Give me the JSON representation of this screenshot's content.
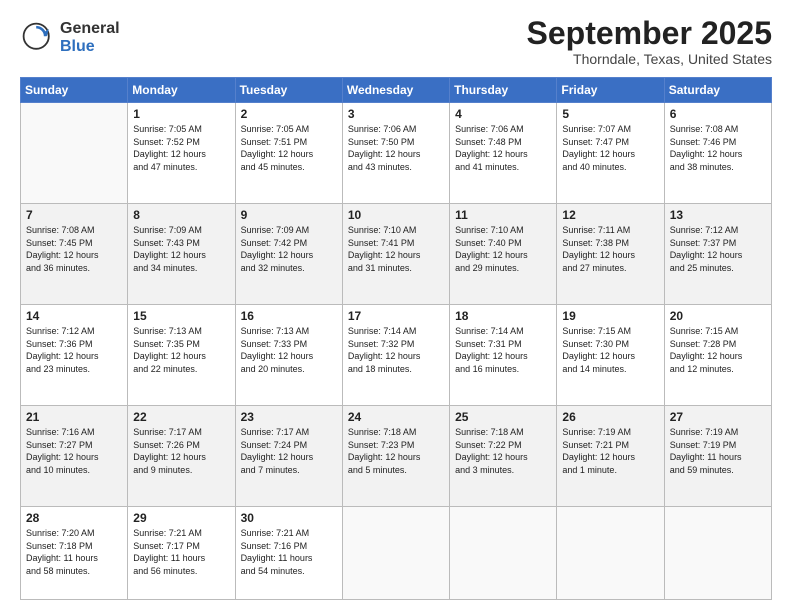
{
  "header": {
    "logo_general": "General",
    "logo_blue": "Blue",
    "month_title": "September 2025",
    "location": "Thorndale, Texas, United States"
  },
  "days_of_week": [
    "Sunday",
    "Monday",
    "Tuesday",
    "Wednesday",
    "Thursday",
    "Friday",
    "Saturday"
  ],
  "weeks": [
    [
      {
        "day": "",
        "info": ""
      },
      {
        "day": "1",
        "info": "Sunrise: 7:05 AM\nSunset: 7:52 PM\nDaylight: 12 hours\nand 47 minutes."
      },
      {
        "day": "2",
        "info": "Sunrise: 7:05 AM\nSunset: 7:51 PM\nDaylight: 12 hours\nand 45 minutes."
      },
      {
        "day": "3",
        "info": "Sunrise: 7:06 AM\nSunset: 7:50 PM\nDaylight: 12 hours\nand 43 minutes."
      },
      {
        "day": "4",
        "info": "Sunrise: 7:06 AM\nSunset: 7:48 PM\nDaylight: 12 hours\nand 41 minutes."
      },
      {
        "day": "5",
        "info": "Sunrise: 7:07 AM\nSunset: 7:47 PM\nDaylight: 12 hours\nand 40 minutes."
      },
      {
        "day": "6",
        "info": "Sunrise: 7:08 AM\nSunset: 7:46 PM\nDaylight: 12 hours\nand 38 minutes."
      }
    ],
    [
      {
        "day": "7",
        "info": "Sunrise: 7:08 AM\nSunset: 7:45 PM\nDaylight: 12 hours\nand 36 minutes."
      },
      {
        "day": "8",
        "info": "Sunrise: 7:09 AM\nSunset: 7:43 PM\nDaylight: 12 hours\nand 34 minutes."
      },
      {
        "day": "9",
        "info": "Sunrise: 7:09 AM\nSunset: 7:42 PM\nDaylight: 12 hours\nand 32 minutes."
      },
      {
        "day": "10",
        "info": "Sunrise: 7:10 AM\nSunset: 7:41 PM\nDaylight: 12 hours\nand 31 minutes."
      },
      {
        "day": "11",
        "info": "Sunrise: 7:10 AM\nSunset: 7:40 PM\nDaylight: 12 hours\nand 29 minutes."
      },
      {
        "day": "12",
        "info": "Sunrise: 7:11 AM\nSunset: 7:38 PM\nDaylight: 12 hours\nand 27 minutes."
      },
      {
        "day": "13",
        "info": "Sunrise: 7:12 AM\nSunset: 7:37 PM\nDaylight: 12 hours\nand 25 minutes."
      }
    ],
    [
      {
        "day": "14",
        "info": "Sunrise: 7:12 AM\nSunset: 7:36 PM\nDaylight: 12 hours\nand 23 minutes."
      },
      {
        "day": "15",
        "info": "Sunrise: 7:13 AM\nSunset: 7:35 PM\nDaylight: 12 hours\nand 22 minutes."
      },
      {
        "day": "16",
        "info": "Sunrise: 7:13 AM\nSunset: 7:33 PM\nDaylight: 12 hours\nand 20 minutes."
      },
      {
        "day": "17",
        "info": "Sunrise: 7:14 AM\nSunset: 7:32 PM\nDaylight: 12 hours\nand 18 minutes."
      },
      {
        "day": "18",
        "info": "Sunrise: 7:14 AM\nSunset: 7:31 PM\nDaylight: 12 hours\nand 16 minutes."
      },
      {
        "day": "19",
        "info": "Sunrise: 7:15 AM\nSunset: 7:30 PM\nDaylight: 12 hours\nand 14 minutes."
      },
      {
        "day": "20",
        "info": "Sunrise: 7:15 AM\nSunset: 7:28 PM\nDaylight: 12 hours\nand 12 minutes."
      }
    ],
    [
      {
        "day": "21",
        "info": "Sunrise: 7:16 AM\nSunset: 7:27 PM\nDaylight: 12 hours\nand 10 minutes."
      },
      {
        "day": "22",
        "info": "Sunrise: 7:17 AM\nSunset: 7:26 PM\nDaylight: 12 hours\nand 9 minutes."
      },
      {
        "day": "23",
        "info": "Sunrise: 7:17 AM\nSunset: 7:24 PM\nDaylight: 12 hours\nand 7 minutes."
      },
      {
        "day": "24",
        "info": "Sunrise: 7:18 AM\nSunset: 7:23 PM\nDaylight: 12 hours\nand 5 minutes."
      },
      {
        "day": "25",
        "info": "Sunrise: 7:18 AM\nSunset: 7:22 PM\nDaylight: 12 hours\nand 3 minutes."
      },
      {
        "day": "26",
        "info": "Sunrise: 7:19 AM\nSunset: 7:21 PM\nDaylight: 12 hours\nand 1 minute."
      },
      {
        "day": "27",
        "info": "Sunrise: 7:19 AM\nSunset: 7:19 PM\nDaylight: 11 hours\nand 59 minutes."
      }
    ],
    [
      {
        "day": "28",
        "info": "Sunrise: 7:20 AM\nSunset: 7:18 PM\nDaylight: 11 hours\nand 58 minutes."
      },
      {
        "day": "29",
        "info": "Sunrise: 7:21 AM\nSunset: 7:17 PM\nDaylight: 11 hours\nand 56 minutes."
      },
      {
        "day": "30",
        "info": "Sunrise: 7:21 AM\nSunset: 7:16 PM\nDaylight: 11 hours\nand 54 minutes."
      },
      {
        "day": "",
        "info": ""
      },
      {
        "day": "",
        "info": ""
      },
      {
        "day": "",
        "info": ""
      },
      {
        "day": "",
        "info": ""
      }
    ]
  ]
}
